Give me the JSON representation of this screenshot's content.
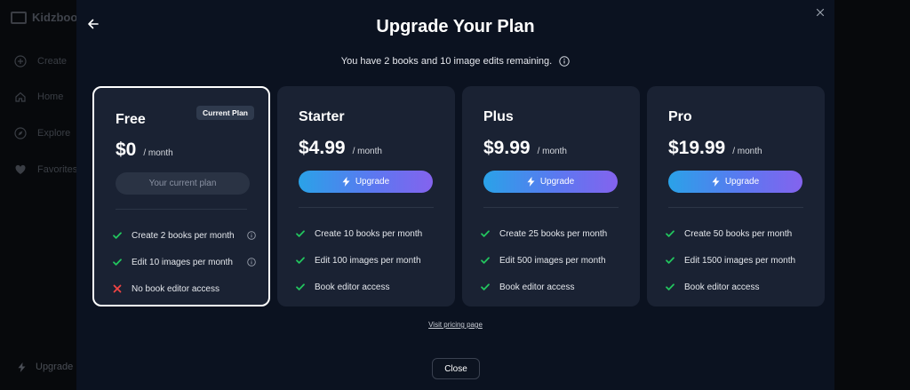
{
  "app": {
    "name": "Kidzbook"
  },
  "sidebar": {
    "items": [
      {
        "label": "Create",
        "icon": "plus-circle-icon"
      },
      {
        "label": "Home",
        "icon": "home-icon"
      },
      {
        "label": "Explore",
        "icon": "compass-icon"
      },
      {
        "label": "Favorites",
        "icon": "heart-icon"
      }
    ],
    "upgrade_label": "Upgrade"
  },
  "modal": {
    "title": "Upgrade Your Plan",
    "subtitle": "You have 2 books and 10 image edits remaining.",
    "pricing_link": "Visit pricing page",
    "close_label": "Close"
  },
  "plans": [
    {
      "name": "Free",
      "badge": "Current Plan",
      "price": "$0",
      "per": "/ month",
      "button": "Your current plan",
      "is_current": true,
      "features": [
        {
          "text": "Create 2 books per month",
          "included": true,
          "info": true
        },
        {
          "text": "Edit 10 images per month",
          "included": true,
          "info": true
        },
        {
          "text": "No book editor access",
          "included": false,
          "info": false
        }
      ]
    },
    {
      "name": "Starter",
      "price": "$4.99",
      "per": "/ month",
      "button": "Upgrade",
      "is_current": false,
      "features": [
        {
          "text": "Create 10 books per month",
          "included": true
        },
        {
          "text": "Edit 100 images per month",
          "included": true
        },
        {
          "text": "Book editor access",
          "included": true
        }
      ]
    },
    {
      "name": "Plus",
      "price": "$9.99",
      "per": "/ month",
      "button": "Upgrade",
      "is_current": false,
      "features": [
        {
          "text": "Create 25 books per month",
          "included": true
        },
        {
          "text": "Edit 500 images per month",
          "included": true
        },
        {
          "text": "Book editor access",
          "included": true
        }
      ]
    },
    {
      "name": "Pro",
      "price": "$19.99",
      "per": "/ month",
      "button": "Upgrade",
      "is_current": false,
      "features": [
        {
          "text": "Create 50 books per month",
          "included": true
        },
        {
          "text": "Edit 1500 images per month",
          "included": true
        },
        {
          "text": "Book editor access",
          "included": true
        }
      ]
    }
  ],
  "colors": {
    "modal_bg": "#0b1220",
    "card_bg": "#1a2233",
    "check": "#22c55e",
    "cross": "#ef4444",
    "gradient_start": "#2aa2e8",
    "gradient_end": "#8463ee"
  }
}
